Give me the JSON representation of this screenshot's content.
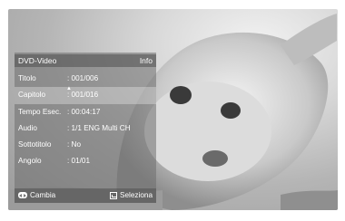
{
  "panel": {
    "title": "DVD-Video",
    "header_right": "Info",
    "rows": [
      {
        "label": "Titolo",
        "value": ": 001/006"
      },
      {
        "label": "Capitolo",
        "value": ": 001/016"
      },
      {
        "label": "Tempo Esec.",
        "value": ": 00:04:17"
      },
      {
        "label": "Audio",
        "value": ": 1/1 ENG Multi CH"
      },
      {
        "label": "Sottotitolo",
        "value": ": No"
      },
      {
        "label": "Angolo",
        "value": ": 01/01"
      }
    ],
    "selected_row": "Capitolo",
    "footer": {
      "change_label": "Cambia",
      "select_label": "Seleziona"
    }
  },
  "icons": {
    "change": "left-right-arrows-icon",
    "select": "enter-icon"
  }
}
